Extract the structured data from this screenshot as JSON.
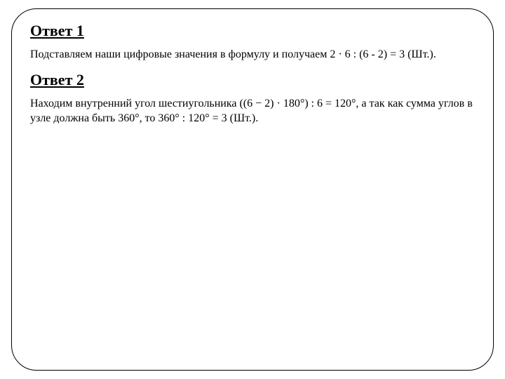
{
  "answers": [
    {
      "heading": "Ответ 1",
      "text": "Подставляем наши цифровые значения в формулу и получаем 2 · 6 : (6 - 2) = 3 (Шт.)."
    },
    {
      "heading": "Ответ 2",
      "text": "Находим внутренний угол шестиугольника ((6 − 2) · 180°) : 6 = 120°, а так как сумма углов в узле должна быть 360°, то 360° : 120° = 3 (Шт.)."
    }
  ]
}
